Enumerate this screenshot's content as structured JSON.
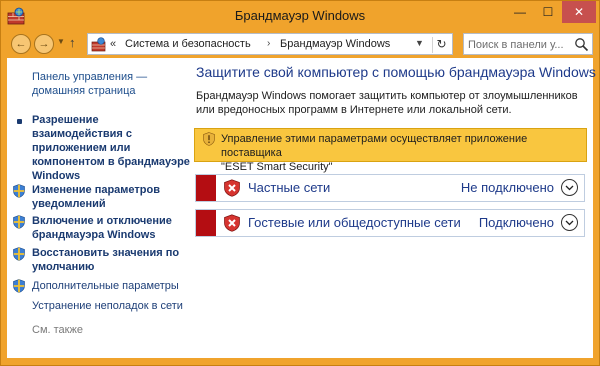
{
  "window": {
    "title": "Брандмауэр Windows",
    "controls": {
      "minimize": "—",
      "maximize": "☐",
      "close": "✕"
    }
  },
  "nav": {
    "breadcrumb_prefix": "«",
    "breadcrumbs": [
      "Система и безопасность",
      "Брандмауэр Windows"
    ],
    "breadcrumb_separator": "›",
    "search_placeholder": "Поиск в панели у..."
  },
  "sidebar": {
    "home_link": "Панель управления — домашняя страница",
    "items": [
      {
        "label": "Разрешение взаимодействия с приложением или компонентом в брандмауэре Windows",
        "icon": "bullet-icon",
        "bold": true
      },
      {
        "label": "Изменение параметров уведомлений",
        "icon": "shield-icon",
        "bold": true
      },
      {
        "label": "Включение и отключение брандмауэра Windows",
        "icon": "shield-icon",
        "bold": true
      },
      {
        "label": "Восстановить значения по умолчанию",
        "icon": "shield-icon",
        "bold": true
      },
      {
        "label": "Дополнительные параметры",
        "icon": "shield-icon",
        "bold": false
      },
      {
        "label": "Устранение неполадок в сети",
        "icon": "none",
        "bold": false
      }
    ],
    "see_also": "См. также"
  },
  "main": {
    "title": "Защитите свой компьютер с помощью брандмауэра Windows",
    "description": "Брандмауэр Windows помогает защитить компьютер от злоумышленников или вредоносных программ в Интернете или локальной сети.",
    "notice": {
      "line1": "Управление этими параметрами осуществляет приложение поставщика",
      "line2": "\"ESET Smart Security\""
    },
    "networks": [
      {
        "label": "Частные сети",
        "status": "Не подключено"
      },
      {
        "label": "Гостевые или общедоступные сети",
        "status": "Подключено"
      }
    ]
  },
  "colors": {
    "window_frame": "#f0a32c",
    "notice_bg": "#f9c63f",
    "network_stripe": "#b40d12",
    "link": "#1e3a8a"
  }
}
